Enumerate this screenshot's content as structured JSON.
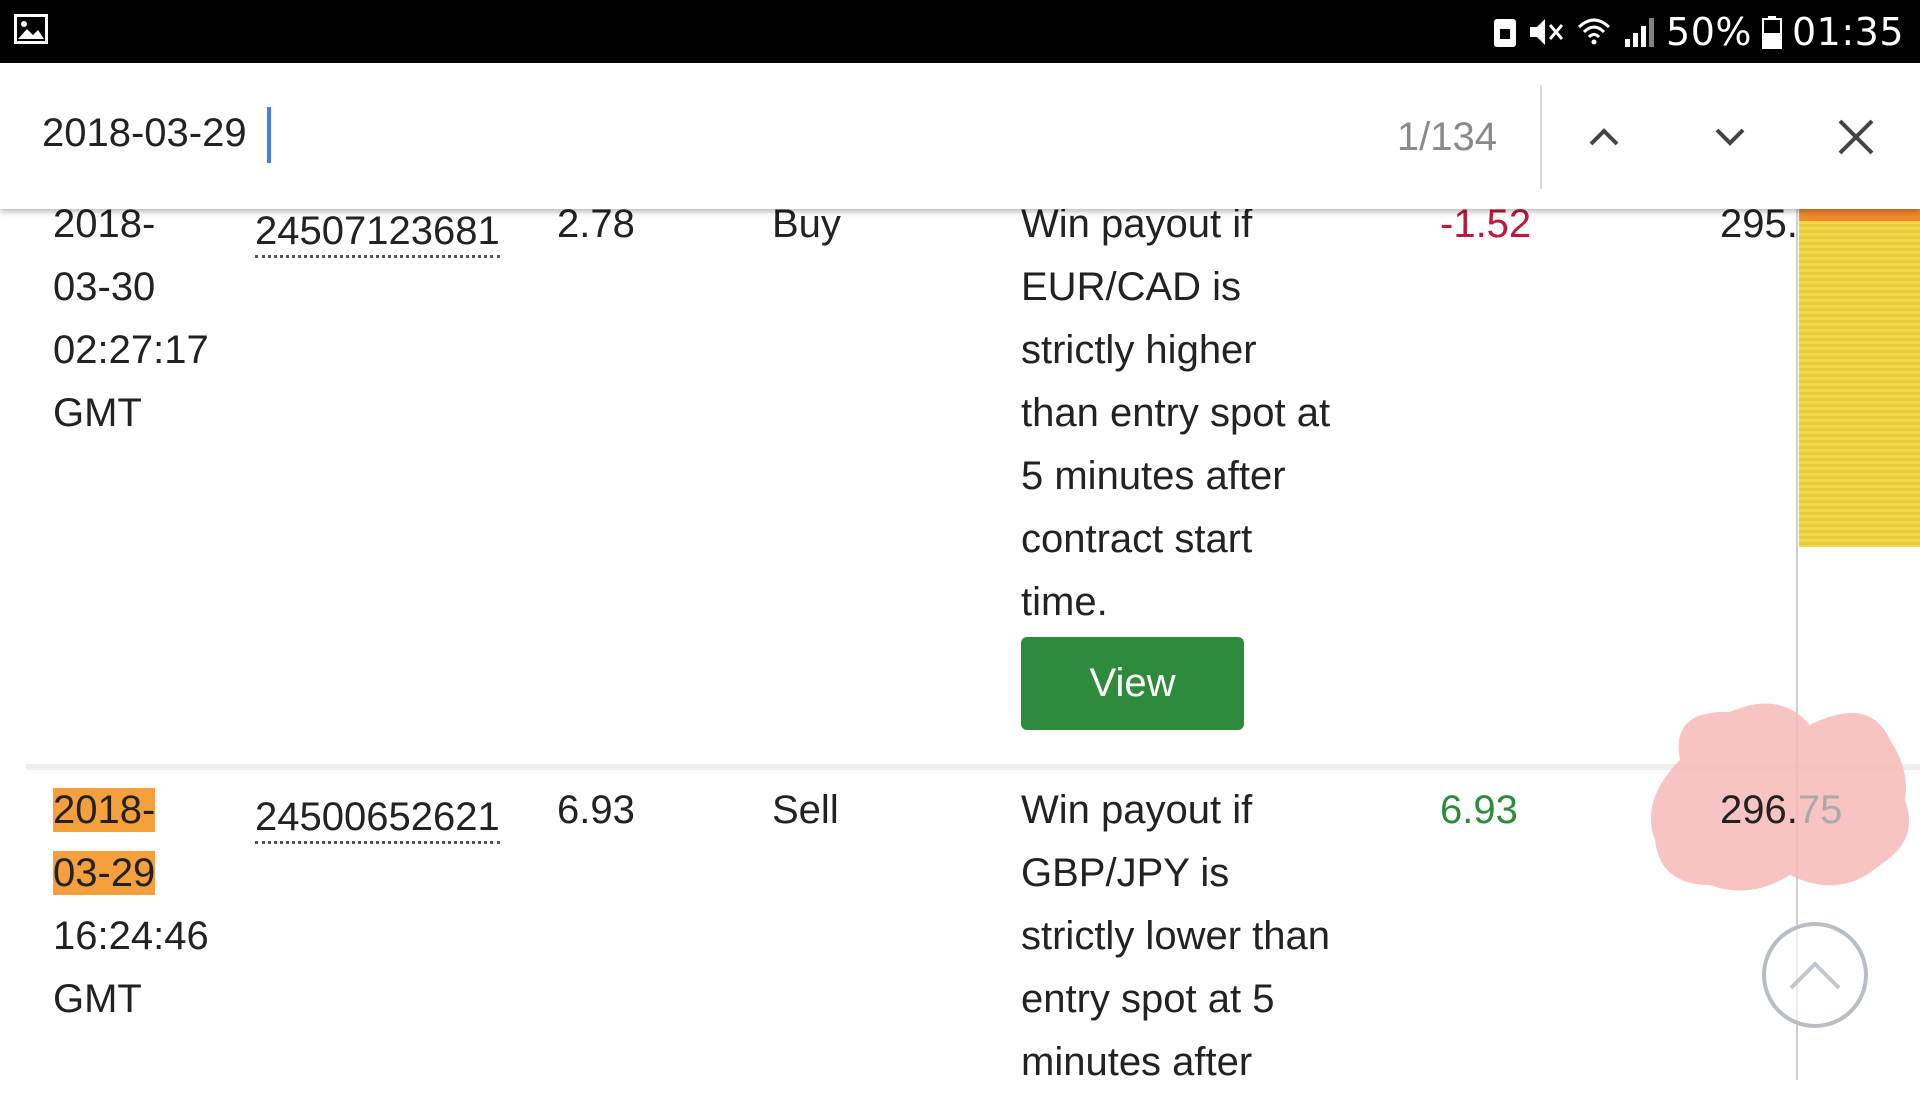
{
  "status_bar": {
    "battery": "50%",
    "time": "01:35",
    "icons": [
      "gallery-icon",
      "nfc-icon",
      "mute-icon",
      "wifi-icon",
      "signal-icon",
      "battery-icon"
    ]
  },
  "find_bar": {
    "query": "2018-03-29",
    "match_count": "1/134",
    "icons": [
      "chevron-up-icon",
      "chevron-down-icon",
      "close-icon"
    ]
  },
  "rows": [
    {
      "date_line1": "2018-",
      "date_line2": "03-30",
      "time": "02:27:17",
      "tz": "GMT",
      "ref": "24507123681",
      "price": "2.78",
      "action": "Buy",
      "desc": [
        "Win payout if",
        "EUR/CAD is",
        "strictly higher",
        "than entry spot at",
        "5 minutes after",
        "contract start",
        "time."
      ],
      "pl": "-1.52",
      "balance": "295."
    },
    {
      "date_line1": "2018-",
      "date_line2": "03-29",
      "time": "16:24:46",
      "tz": "GMT",
      "ref": "24500652621",
      "price": "6.93",
      "action": "Sell",
      "desc": [
        "Win payout if",
        "GBP/JPY is",
        "strictly lower than",
        "entry spot at 5",
        "minutes after"
      ],
      "pl": "6.93",
      "balance_main": "296.",
      "balance_faded": "75"
    }
  ],
  "view_button": "View",
  "colors": {
    "negative": "#c0183a",
    "positive": "#2e8b3c",
    "highlight": "#f5a03c",
    "button": "#2e8b3c",
    "caret": "#4a7fe0"
  }
}
